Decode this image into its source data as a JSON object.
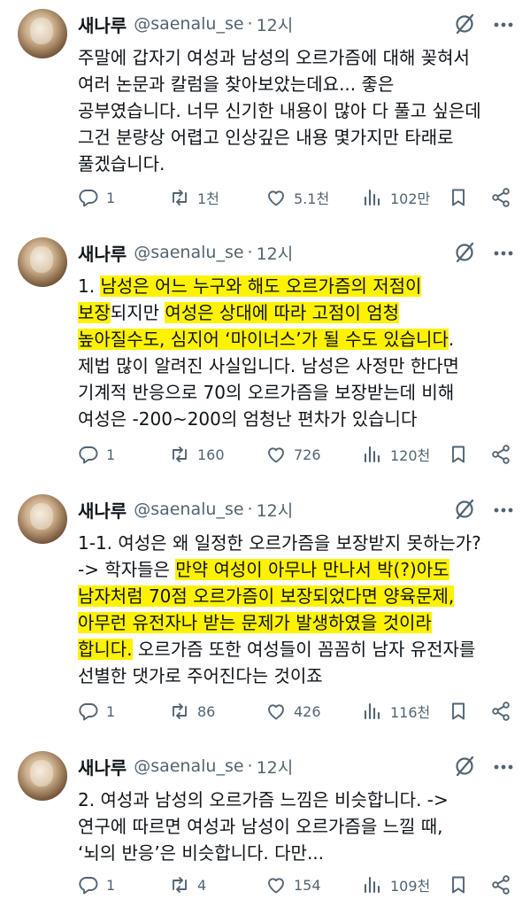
{
  "tweets": [
    {
      "name": "새나루",
      "handle": "@saenalu_se",
      "sep": "·",
      "time": "12시",
      "lines": [
        [
          {
            "t": "주말에 갑자기 여성과 남성의 오르가즘에 대해 꽂혀서"
          }
        ],
        [
          {
            "t": "여러 논문과 칼럼을 찾아보았는데요... 좋은"
          }
        ],
        [
          {
            "t": "공부였습니다. 너무 신기한 내용이 많아 다 풀고 싶은데"
          }
        ],
        [
          {
            "t": "그건 분량상 어렵고 인상깊은 내용 몇가지만 타래로"
          }
        ],
        [
          {
            "t": "풀겠습니다."
          }
        ]
      ],
      "replies": "1",
      "retweets": "1천",
      "likes": "5.1천",
      "views": "102만"
    },
    {
      "name": "새나루",
      "handle": "@saenalu_se",
      "sep": "·",
      "time": "12시",
      "lines": [
        [
          {
            "t": "1. "
          },
          {
            "t": "남성은 어느 누구와 해도 오르가즘의 저점이",
            "h": true
          }
        ],
        [
          {
            "t": "보장",
            "h": true
          },
          {
            "t": "되지만 "
          },
          {
            "t": "여성은 상대에 따라 고점이 엄청",
            "h": true
          }
        ],
        [
          {
            "t": "높아질수도, 심지어 ‘마이너스’가 될 수도 있습니다",
            "h": true
          },
          {
            "t": "."
          }
        ],
        [
          {
            "t": "제법 많이 알려진 사실입니다. 남성은 사정만 한다면"
          }
        ],
        [
          {
            "t": "기계적 반응으로 70의 오르가즘을 보장받는데 비해"
          }
        ],
        [
          {
            "t": "여성은 -200~200의 엄청난 편차가 있습니다"
          }
        ]
      ],
      "replies": "1",
      "retweets": "160",
      "likes": "726",
      "views": "120천"
    },
    {
      "name": "새나루",
      "handle": "@saenalu_se",
      "sep": "·",
      "time": "12시",
      "lines": [
        [
          {
            "t": "1-1. 여성은 왜 일정한 오르가즘을 보장받지 못하는가?"
          }
        ],
        [
          {
            "t": "-> 학자들은 "
          },
          {
            "t": "만약 여성이 아무나 만나서 박(?)아도",
            "h": true
          }
        ],
        [
          {
            "t": "남자처럼 70점 오르가즘이 보장되었다면 양육문제,",
            "h": true
          }
        ],
        [
          {
            "t": "아무런 유전자나 받는 문제가 발생하였을 것이라",
            "h": true
          }
        ],
        [
          {
            "t": "합니다.",
            "h": true
          },
          {
            "t": " 오르가즘 또한 여성들이 꼼꼼히 남자 유전자를"
          }
        ],
        [
          {
            "t": "선별한 댓가로 주어진다는 것이죠"
          }
        ]
      ],
      "replies": "1",
      "retweets": "86",
      "likes": "426",
      "views": "116천"
    },
    {
      "name": "새나루",
      "handle": "@saenalu_se",
      "sep": "·",
      "time": "12시",
      "lines": [
        [
          {
            "t": "2. 여성과 남성의 오르가즘 느낌은 비슷합니다. ->"
          }
        ],
        [
          {
            "t": "연구에 따르면 여성과 남성이 오르가즘을 느낄 때,"
          }
        ],
        [
          {
            "t": "‘뇌의 반응’은 비슷합니다. 다만..."
          }
        ]
      ],
      "replies": "1",
      "retweets": "4",
      "likes": "154",
      "views": "109천"
    }
  ]
}
